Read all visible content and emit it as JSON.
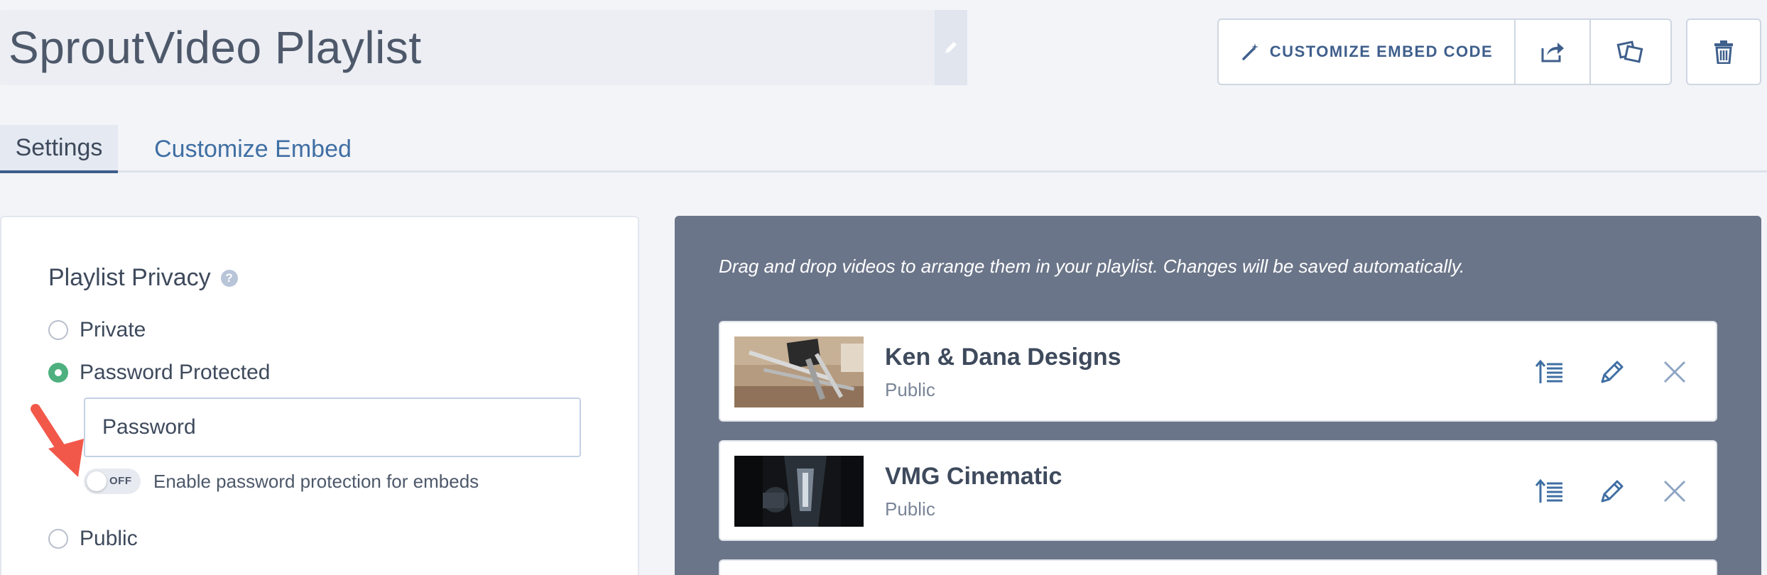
{
  "header": {
    "title": "SproutVideo Playlist",
    "customize_embed_code_label": "CUSTOMIZE EMBED CODE"
  },
  "tabs": [
    {
      "label": "Settings",
      "active": true
    },
    {
      "label": "Customize Embed",
      "active": false
    }
  ],
  "privacy": {
    "title": "Playlist Privacy",
    "help_glyph": "?",
    "options": [
      {
        "label": "Private",
        "checked": false
      },
      {
        "label": "Password Protected",
        "checked": true
      },
      {
        "label": "Public",
        "checked": false
      }
    ],
    "password_placeholder": "Password",
    "embed_toggle": {
      "state_label": "OFF",
      "label": "Enable password protection for embeds"
    }
  },
  "playlist": {
    "hint": "Drag and drop videos to arrange them in your playlist. Changes will be saved automatically.",
    "videos": [
      {
        "title": "Ken & Dana Designs",
        "status": "Public"
      },
      {
        "title": "VMG Cinematic",
        "status": "Public"
      }
    ]
  },
  "colors": {
    "accent_blue": "#3f5f8c",
    "link_blue": "#3f6fa3",
    "radio_green": "#4eb07e",
    "panel_slate": "#6b7589",
    "annotation_red": "#f2584a"
  },
  "icons": {
    "title_edit": "pencil-icon",
    "customize": "magic-wand-icon",
    "share": "share-icon",
    "copy": "copy-icon",
    "delete": "trash-icon",
    "reorder": "move-to-top-icon",
    "edit": "pencil-icon",
    "remove": "close-icon"
  }
}
